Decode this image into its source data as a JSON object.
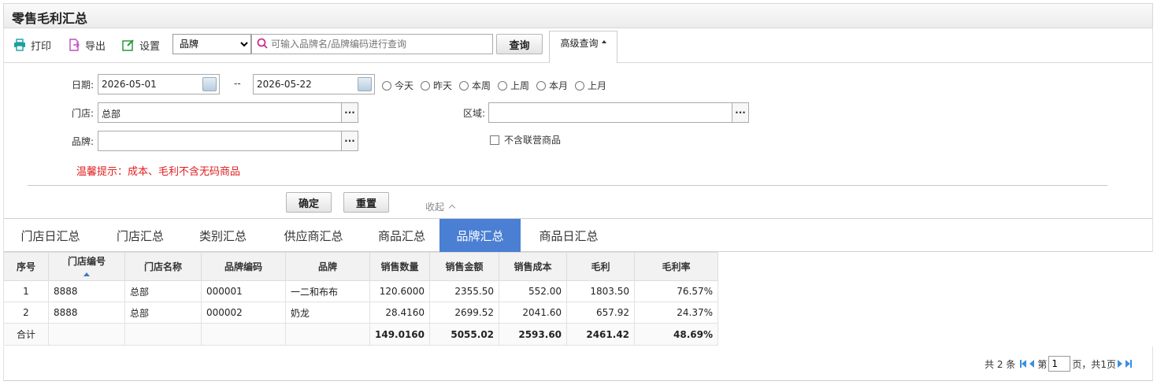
{
  "page": {
    "title": "零售毛利汇总"
  },
  "toolbar": {
    "print_label": "打印",
    "export_label": "导出",
    "settings_label": "设置",
    "select_value": "品牌",
    "search_placeholder": "可输入品牌名/品牌编码进行查询",
    "query_label": "查询",
    "advanced_label": "高级查询"
  },
  "filter": {
    "date_label": "日期:",
    "date_from": "2026-05-01",
    "date_sep": "--",
    "date_to": "2026-05-22",
    "ranges": [
      "今天",
      "昨天",
      "本周",
      "上周",
      "本月",
      "上月"
    ],
    "store_label": "门店:",
    "store_value": "总部",
    "region_label": "区域:",
    "region_value": "",
    "brand_label": "品牌:",
    "brand_value": "",
    "exclude_label": "不含联营商品",
    "tip": "温馨提示：成本、毛利不含无码商品",
    "confirm_label": "确定",
    "reset_label": "重置",
    "collapse_label": "收起"
  },
  "tabs": [
    "门店日汇总",
    "门店汇总",
    "类别汇总",
    "供应商汇总",
    "商品汇总",
    "品牌汇总",
    "商品日汇总"
  ],
  "active_tab": "品牌汇总",
  "table": {
    "headers": [
      "序号",
      "门店编号",
      "门店名称",
      "品牌编码",
      "品牌",
      "销售数量",
      "销售金额",
      "销售成本",
      "毛利",
      "毛利率"
    ],
    "rows": [
      [
        "1",
        "8888",
        "总部",
        "000001",
        "一二和布布",
        "120.6000",
        "2355.50",
        "552.00",
        "1803.50",
        "76.57%"
      ],
      [
        "2",
        "8888",
        "总部",
        "000002",
        "奶龙",
        "28.4160",
        "2699.52",
        "2041.60",
        "657.92",
        "24.37%"
      ]
    ],
    "total": [
      "合计",
      "",
      "",
      "",
      "",
      "149.0160",
      "5055.02",
      "2593.60",
      "2461.42",
      "48.69%"
    ]
  },
  "pager": {
    "total_text": "共 2 条",
    "page_prefix": "第",
    "page_value": "1",
    "page_suffix": "页，共1页"
  },
  "colors": {
    "accent": "#4a7fd3",
    "tip": "#e02020"
  }
}
